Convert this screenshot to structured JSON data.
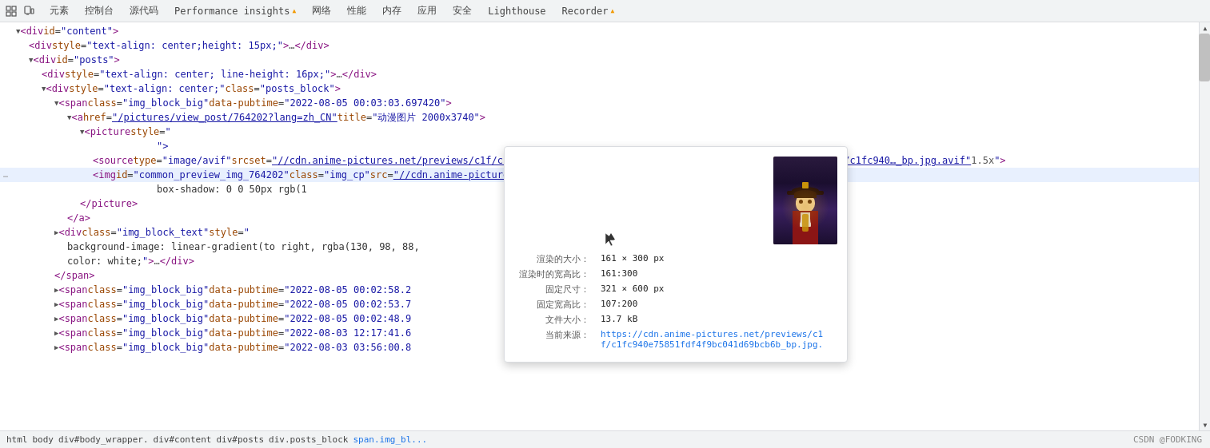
{
  "tabs": [
    {
      "label": "元素",
      "active": false
    },
    {
      "label": "控制台",
      "active": false
    },
    {
      "label": "源代码",
      "active": false
    },
    {
      "label": "Performance insights",
      "active": false,
      "badge": true
    },
    {
      "label": "网络",
      "active": false
    },
    {
      "label": "性能",
      "active": false
    },
    {
      "label": "内存",
      "active": false
    },
    {
      "label": "应用",
      "active": false
    },
    {
      "label": "安全",
      "active": false
    },
    {
      "label": "Lighthouse",
      "active": false
    },
    {
      "label": "Recorder",
      "active": false,
      "badge": true
    }
  ],
  "dom_lines": [
    {
      "indent": 16,
      "content": "<div id=\"content\">",
      "has_triangle": true,
      "triangle_open": true
    },
    {
      "indent": 32,
      "content": "<div style=\"text-align: center;height: 15px;\">…</div>",
      "has_triangle": false
    },
    {
      "indent": 32,
      "content": "<div id=\"posts\">",
      "has_triangle": true,
      "triangle_open": true
    },
    {
      "indent": 48,
      "content": "<div style=\"text-align: center; line-height: 16px;\">…</div>",
      "has_triangle": false
    },
    {
      "indent": 48,
      "content": "<div style=\"text-align: center;\" class=\"posts_block\"",
      "has_triangle": true,
      "triangle_open": true
    },
    {
      "indent": 64,
      "content": "<span class=\"img_block_big\" data-pubtime=\"2022-08-05 00:03:03.697420\">",
      "has_triangle": true,
      "triangle_open": true
    },
    {
      "indent": 80,
      "content": "<a href=\"/pictures/view_post/764202?lang=zh_CN\" title=\"动漫图片 2000x3740\">",
      "has_triangle": true,
      "triangle_open": true
    },
    {
      "indent": 96,
      "content": "<picture style=\"",
      "has_triangle": true,
      "triangle_open": true
    },
    {
      "indent": 128,
      "content": "\">",
      "has_triangle": false
    },
    {
      "indent": 112,
      "content": "<source type=\"image/avif\" srcset=\"//cdn.anime-pictures.net/previews/c1f/c1fc940...cp.jpg.avif, //cdn.anime-pictures.net/previews/c1f/c1fc940...bp.jpg.avif 1.5x\">",
      "has_triangle": false,
      "is_long": true
    },
    {
      "indent": 112,
      "content": "<img id=\"common_preview_img_764202\" class=\"img_cp\" src=\"//cdn.anime-pictures.net/previews/c1f/c1fc940...cp.jpg\" style=\"",
      "has_triangle": false,
      "is_selected": true
    },
    {
      "indent": 192,
      "content": "box-shadow: 0 0 50px rgb(1",
      "has_triangle": false,
      "is_inline": true
    }
  ],
  "dom_lines_after": [
    {
      "indent": 96,
      "content": "</picture>"
    },
    {
      "indent": 80,
      "content": "</a>"
    },
    {
      "indent": 64,
      "content": "<div class=\"img_block_text\" style=\""
    },
    {
      "indent": 96,
      "content": "background-image: linear-gradient(to right, rgba(130, 98, 88,"
    },
    {
      "indent": 96,
      "content": "color: white;\">…</div>"
    },
    {
      "indent": 64,
      "content": "</span>"
    },
    {
      "indent": 64,
      "content": "<span class=\"img_block_big\" data-pubtime=\"2022-08-05 00:02:58.2"
    },
    {
      "indent": 64,
      "content": "<span class=\"img_block_big\" data-pubtime=\"2022-08-05 00:02:53.7"
    },
    {
      "indent": 64,
      "content": "<span class=\"img_block_big\" data-pubtime=\"2022-08-05 00:02:48.9"
    },
    {
      "indent": 64,
      "content": "<span class=\"img_block_big\" data-pubtime=\"2022-08-03 12:17:41.6"
    },
    {
      "indent": 64,
      "content": "<span class=\"img_block_big\" data-pubtime=\"2022-08-03 03:56:00.8"
    }
  ],
  "tooltip": {
    "rendered_size_label": "渲染的大小：",
    "rendered_size": "161 × 300 px",
    "rendered_ratio_label": "渲染时的宽高比：",
    "rendered_ratio": "161:300",
    "fixed_size_label": "固定尺寸：",
    "fixed_size": "321 × 600 px",
    "fixed_ratio_label": "固定宽高比：",
    "fixed_ratio": "107:200",
    "file_size_label": "文件大小：",
    "file_size": "13.7 kB",
    "source_label": "当前来源：",
    "source_url": "https://cdn.anime-pictures.net/previews/c1f/c1fc940e75851fdf4f9bc041d69bcb6b_bp.jpg."
  },
  "breadcrumb": {
    "items": [
      "html",
      "body",
      "div#body_wrapper.",
      "div#content",
      "div#posts",
      "div.posts_block",
      "span.img_bl..."
    ]
  },
  "watermark": "CSDN @FODKING"
}
